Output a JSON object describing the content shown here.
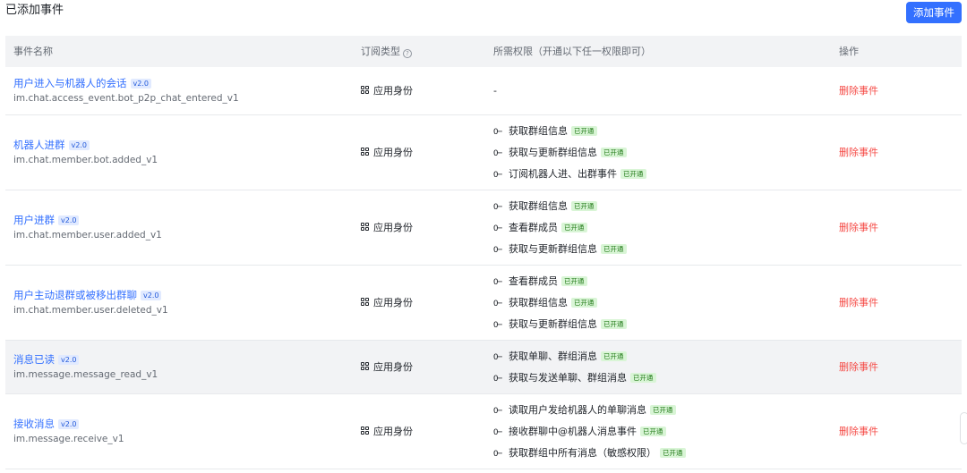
{
  "header": {
    "title": "已添加事件",
    "add_button": "添加事件"
  },
  "columns": {
    "name": "事件名称",
    "subscription": "订阅类型",
    "permissions": "所需权限（开通以下任一权限即可）",
    "actions": "操作"
  },
  "badge_text": "已开通",
  "rows": [
    {
      "title": "用户进入与机器人的会话",
      "version": "v2.0",
      "event_id": "im.chat.access_event.bot_p2p_chat_entered_v1",
      "subscription": "应用身份",
      "permissions_empty": "-",
      "delete_label": "删除事件"
    },
    {
      "title": "机器人进群",
      "version": "v2.0",
      "event_id": "im.chat.member.bot.added_v1",
      "subscription": "应用身份",
      "permissions": [
        "获取群组信息",
        "获取与更新群组信息",
        "订阅机器人进、出群事件"
      ],
      "delete_label": "删除事件"
    },
    {
      "title": "用户进群",
      "version": "v2.0",
      "event_id": "im.chat.member.user.added_v1",
      "subscription": "应用身份",
      "permissions": [
        "获取群组信息",
        "查看群成员",
        "获取与更新群组信息"
      ],
      "delete_label": "删除事件"
    },
    {
      "title": "用户主动退群或被移出群聊",
      "version": "v2.0",
      "event_id": "im.chat.member.user.deleted_v1",
      "subscription": "应用身份",
      "permissions": [
        "查看群成员",
        "获取群组信息",
        "获取与更新群组信息"
      ],
      "delete_label": "删除事件"
    },
    {
      "title": "消息已读",
      "version": "v2.0",
      "event_id": "im.message.message_read_v1",
      "subscription": "应用身份",
      "permissions": [
        "获取单聊、群组消息",
        "获取与发送单聊、群组消息"
      ],
      "delete_label": "删除事件"
    },
    {
      "title": "接收消息",
      "version": "v2.0",
      "event_id": "im.message.receive_v1",
      "subscription": "应用身份",
      "permissions": [
        "读取用户发给机器人的单聊消息",
        "接收群聊中@机器人消息事件",
        "获取群组中所有消息（敏感权限）"
      ],
      "delete_label": "删除事件"
    }
  ]
}
